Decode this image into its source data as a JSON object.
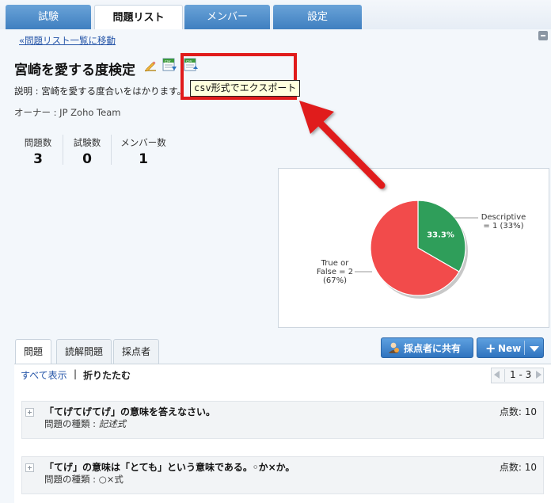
{
  "tabs": [
    "試験",
    "問題リスト",
    "メンバー",
    "設定"
  ],
  "back_link": "«問題リスト一覧に移動",
  "title": "宮崎を愛する度検定",
  "icons": [
    "pencil-edit-icon",
    "csv-import-icon",
    "csv-export-icon",
    "collapse-icon",
    "share-user-icon"
  ],
  "tooltip": "csv形式でエクスポート",
  "description": "説明 : 宮崎を愛する度合いをはかります。",
  "owner": "オーナー : JP Zoho Team",
  "stats": [
    {
      "label": "問題数",
      "value": "3"
    },
    {
      "label": "試験数",
      "value": "0"
    },
    {
      "label": "メンバー数",
      "value": "1"
    }
  ],
  "chart_data": {
    "type": "pie",
    "slices": [
      {
        "label": "Descriptive = 1 (33%)",
        "value": 1,
        "percent": 33.3,
        "color": "#2f9e5a",
        "inner_label": "33.3%"
      },
      {
        "label": "True or False = 2 (67%)",
        "value": 2,
        "percent": 66.7,
        "color": "#f24b4b"
      }
    ]
  },
  "subtabs": [
    "問題",
    "読解問題",
    "採点者"
  ],
  "share_button": "採点者に共有",
  "new_button": "New",
  "show_all": "すべて表示",
  "separator": "|",
  "fold_all": "折りたたむ",
  "pager": "1 - 3",
  "questions": [
    {
      "title": "「てげてげてげ」の意味を答えなさい。",
      "type_label": "問題の種類 :",
      "type": "記述式",
      "score": "点数: 10"
    },
    {
      "title": "「てげ」の意味は「とても」という意味である。◦か×か。",
      "type_label": "問題の種類 :",
      "type": "○×式",
      "score": "点数: 10"
    }
  ],
  "colors": {
    "tab_blue": "#3f7fc0",
    "highlight_red": "#e01b1b",
    "link_blue": "#2555a8"
  }
}
